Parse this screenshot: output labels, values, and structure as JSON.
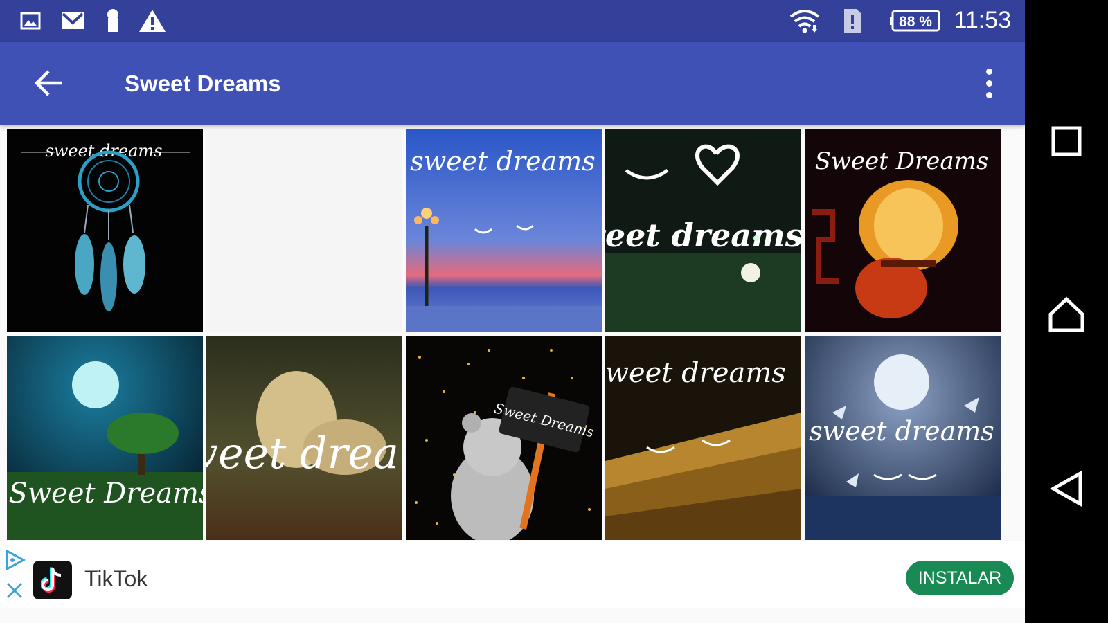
{
  "status_bar": {
    "time": "11:53",
    "battery": "88 %",
    "icons": [
      "image-icon",
      "gmail-icon",
      "keyhole-icon",
      "warning-icon",
      "wifi-icon",
      "no-sim-icon",
      "battery-icon"
    ]
  },
  "app_bar": {
    "title": "Sweet Dreams",
    "back_icon": "arrow-back-icon",
    "menu_icon": "more-vert-icon"
  },
  "grid": {
    "tiles": [
      {
        "id": "dreamcatcher",
        "caption": "sweet dreams"
      },
      {
        "id": "blank",
        "caption": ""
      },
      {
        "id": "seaside-lamp",
        "caption": "sweet dreams"
      },
      {
        "id": "eyelash-heart",
        "caption": "sweet dreams"
      },
      {
        "id": "lanterns",
        "caption": "Sweet Dreams"
      },
      {
        "id": "moon-tree",
        "caption": "Sweet Dreams"
      },
      {
        "id": "lion",
        "caption": "Sweet dreams"
      },
      {
        "id": "teddy",
        "caption": "Sweet Dreams"
      },
      {
        "id": "stairs",
        "caption": "sweet dreams"
      },
      {
        "id": "moon-butterflies",
        "caption": "sweet dreams"
      }
    ]
  },
  "ad": {
    "app_name": "TikTok",
    "button_label": "INSTALAR"
  },
  "nav_bar": {
    "buttons": [
      "recents-icon",
      "home-icon",
      "back-triangle-icon"
    ]
  },
  "colors": {
    "status_bar": "#33419b",
    "app_bar": "#3f51b5",
    "install_button": "#1a8a55"
  }
}
